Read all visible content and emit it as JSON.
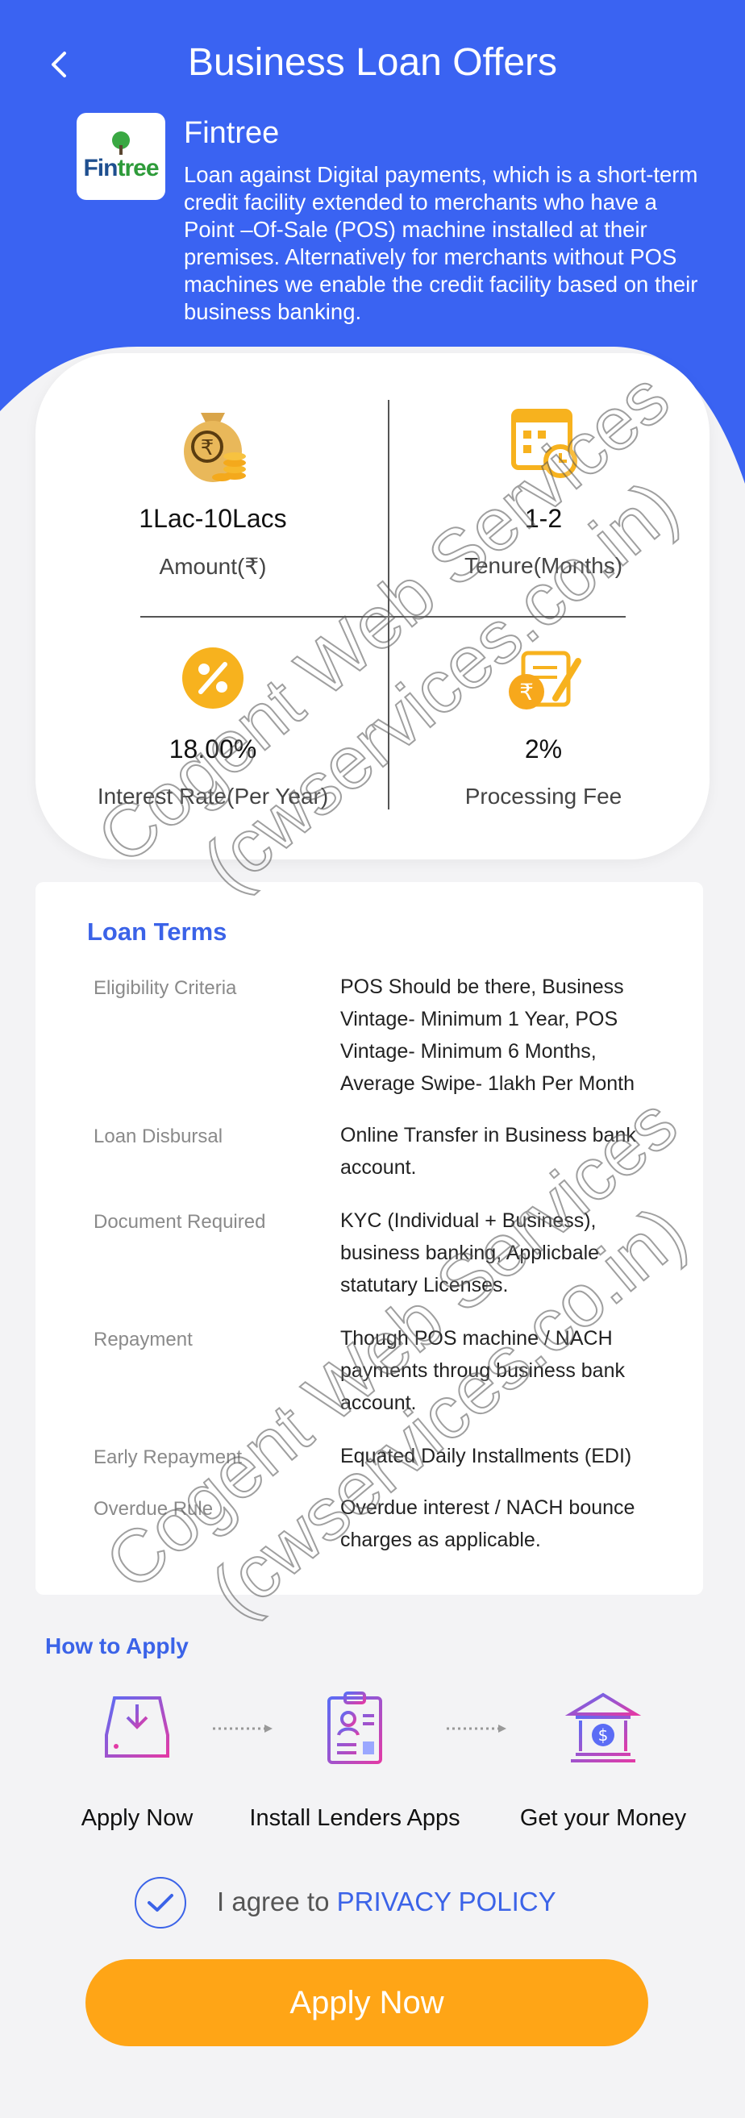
{
  "header": {
    "title": "Business Loan Offers"
  },
  "lender": {
    "logo_text_a": "Fin",
    "logo_text_b": "tree",
    "name": "Fintree",
    "description": "Loan against Digital payments, which is a short-term credit facility extended to merchants who have a Point –Of-Sale (POS) machine installed at their premises. Alternatively for merchants without POS machines we enable the credit facility based on their business banking."
  },
  "stats": {
    "amount": {
      "value": "1Lac-10Lacs",
      "label": "Amount(₹)"
    },
    "tenure": {
      "value": "1-2",
      "label": "Tenure(Months)"
    },
    "interest": {
      "value": "18.00%",
      "label": "Interest Rate(Per Year)"
    },
    "processing": {
      "value": "2%",
      "label": "Processing Fee"
    }
  },
  "loan_terms": {
    "title": "Loan Terms",
    "rows": [
      {
        "key": "Eligibility Criteria",
        "value": "POS Should be there, Business Vintage- Minimum 1 Year, POS Vintage- Minimum 6 Months, Average Swipe- 1lakh Per Month"
      },
      {
        "key": "Loan Disbursal",
        "value": "Online Transfer in Business bank account."
      },
      {
        "key": "Document Required",
        "value": "KYC (Individual + Business), business banking, Applicbale statutary Licenses."
      },
      {
        "key": "Repayment",
        "value": "Though POS machine / NACH payments throug business bank account."
      },
      {
        "key": "Early Repayment",
        "value": "Equated Daily Installments (EDI)"
      },
      {
        "key": "Overdue Rule",
        "value": "Overdue interest / NACH bounce charges as applicable."
      }
    ]
  },
  "how_to_apply": {
    "title": "How to Apply",
    "steps": [
      {
        "label": "Apply Now"
      },
      {
        "label": "Install Lenders Apps"
      },
      {
        "label": "Get your Money"
      }
    ]
  },
  "agreement": {
    "prefix": "I agree to ",
    "link": "PRIVACY POLICY"
  },
  "apply_button": "Apply Now",
  "watermark": {
    "line1": "Cogent Web Services",
    "line2": "(cwservices.co.in)"
  },
  "colors": {
    "primary_blue": "#3a63f2",
    "accent_orange": "#ffa516",
    "link_blue": "#3b63e8"
  }
}
